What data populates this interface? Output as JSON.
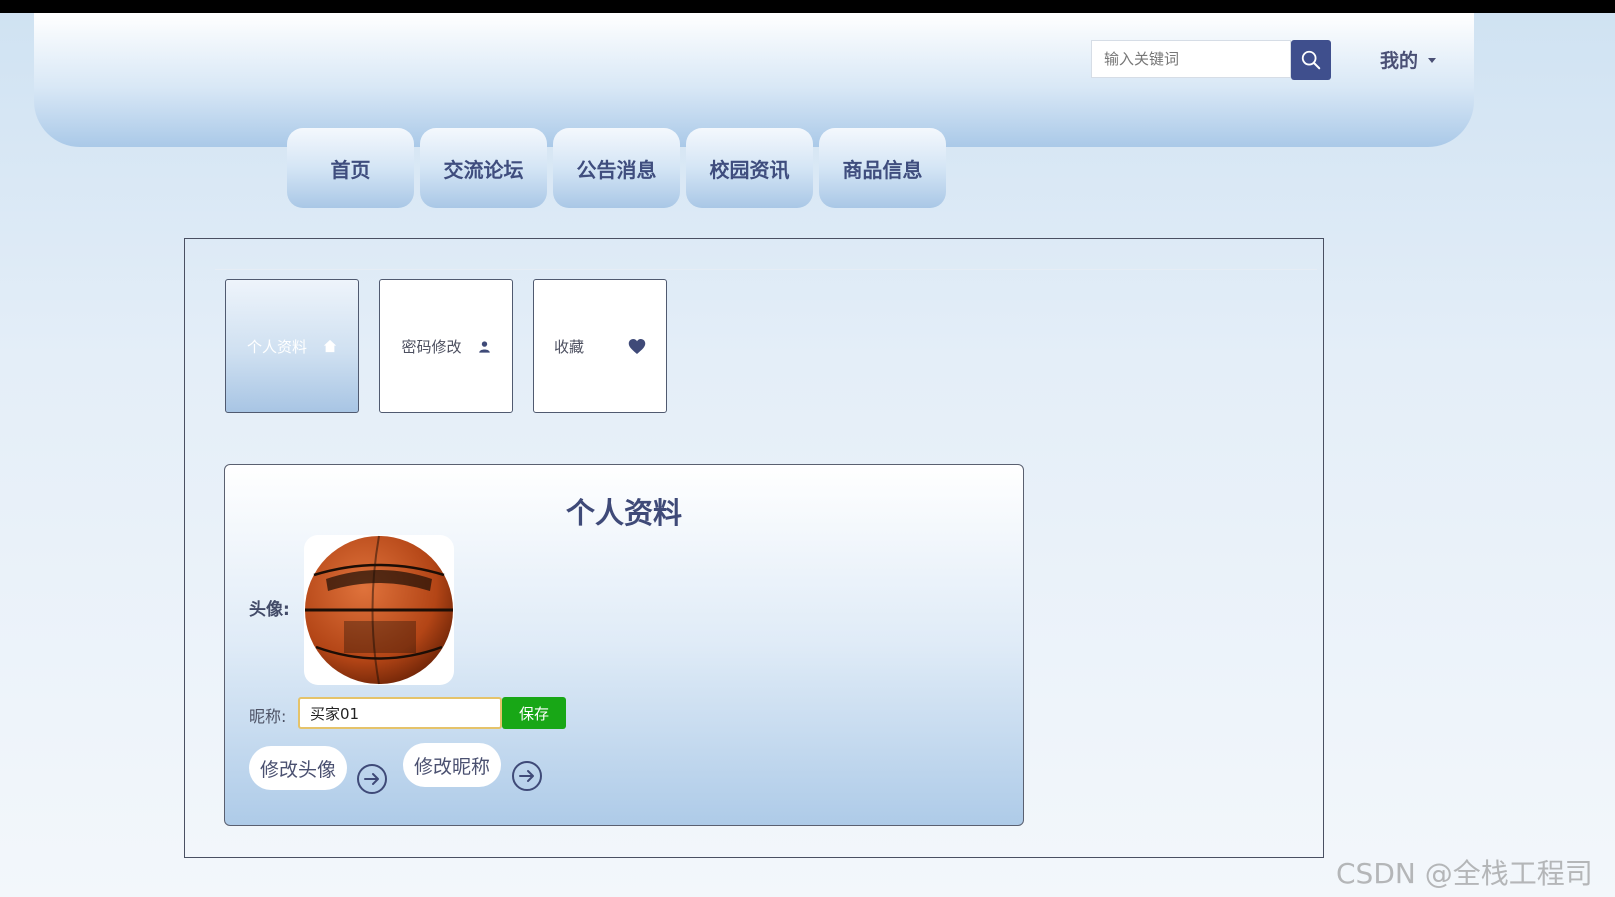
{
  "header": {
    "search": {
      "placeholder": "输入关键词"
    },
    "user_menu_label": "我的"
  },
  "nav": {
    "items": [
      {
        "label": "首页"
      },
      {
        "label": "交流论坛"
      },
      {
        "label": "公告消息"
      },
      {
        "label": "校园资讯"
      },
      {
        "label": "商品信息"
      }
    ]
  },
  "tabs": [
    {
      "label": "个人资料",
      "icon": "home-icon",
      "active": true
    },
    {
      "label": "密码修改",
      "icon": "user-icon",
      "active": false
    },
    {
      "label": "收藏",
      "icon": "heart-icon",
      "active": false
    }
  ],
  "profile": {
    "title": "个人资料",
    "avatar_label": "头像:",
    "nickname_label": "昵称:",
    "nickname_value": "买家01",
    "save_label": "保存",
    "change_avatar_label": "修改头像",
    "change_nickname_label": "修改昵称"
  },
  "watermark": "CSDN @全栈工程司",
  "colors": {
    "accent": "#3f4f8d",
    "save_button": "#18a716",
    "nav_text": "#3f4d7e"
  }
}
